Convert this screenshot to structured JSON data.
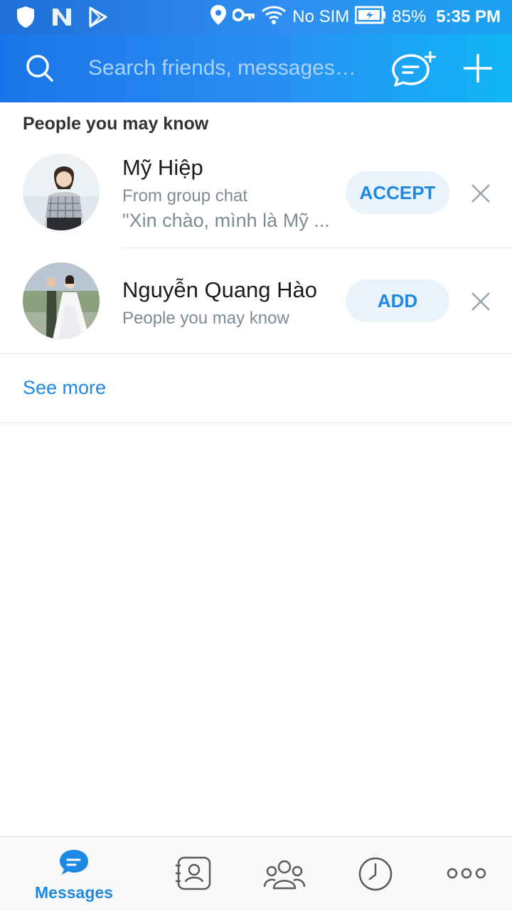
{
  "status_bar": {
    "carrier": "No SIM",
    "battery": "85%",
    "time": "5:35 PM",
    "left_icons": [
      "shield-icon",
      "n-icon",
      "play-store-icon"
    ],
    "right_icons": [
      "location-icon",
      "vpn-key-icon",
      "wifi-icon",
      "battery-icon"
    ]
  },
  "header": {
    "search_placeholder": "Search friends, messages…",
    "icons": [
      "search-icon",
      "new-chat-icon",
      "plus-icon"
    ],
    "gradient": [
      "#1976e8",
      "#10b6f7"
    ]
  },
  "suggestions": {
    "title": "People you may know",
    "items": [
      {
        "name": "Mỹ Hiệp",
        "subtitle": "From group chat",
        "message": "\"Xin chào, mình là Mỹ ...",
        "action": "ACCEPT"
      },
      {
        "name": "Nguyễn Quang Hào",
        "subtitle": "People you may know",
        "action": "ADD"
      }
    ],
    "see_more": "See more"
  },
  "bottom_nav": {
    "active": "Messages",
    "items": [
      {
        "label": "Messages",
        "icon": "chat-bubble-icon"
      },
      {
        "label": "",
        "icon": "contacts-icon"
      },
      {
        "label": "",
        "icon": "group-icon"
      },
      {
        "label": "",
        "icon": "clock-icon"
      },
      {
        "label": "",
        "icon": "more-icon"
      }
    ]
  },
  "colors": {
    "accent": "#1e88e5",
    "pill_bg": "#eaf3fb",
    "secondary_text": "#808a94"
  }
}
